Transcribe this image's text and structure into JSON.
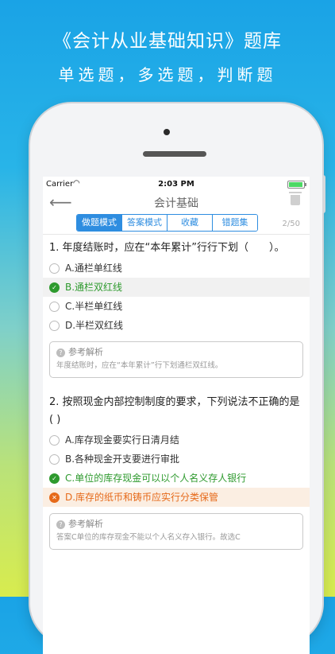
{
  "promo": {
    "headline": "《会计从业基础知识》题库",
    "subline": "单选题，多选题，判断题"
  },
  "statusbar": {
    "carrier": "Carrier",
    "wifi_icon": "wifi-icon",
    "time": "2:03 PM",
    "battery_icon": "battery-icon"
  },
  "navbar": {
    "back_icon": "back-arrow-icon",
    "title": "会计基础",
    "trash_icon": "trash-icon"
  },
  "tabs": {
    "items": [
      {
        "label": "做题模式",
        "active": true
      },
      {
        "label": "答案模式",
        "active": false
      },
      {
        "label": "收藏",
        "active": false
      },
      {
        "label": "错题集",
        "active": false
      }
    ],
    "counter": "2/50"
  },
  "questions": [
    {
      "stem": "1. 年度结账时，应在“本年累计”行行下划（　　）。",
      "options": [
        {
          "label": "A.通栏单红线",
          "state": "none"
        },
        {
          "label": "B.通栏双红线",
          "state": "correct"
        },
        {
          "label": "C.半栏单红线",
          "state": "none"
        },
        {
          "label": "D.半栏双红线",
          "state": "none"
        }
      ],
      "analysis_title": "参考解析",
      "analysis_text": "年度结账时，应在“本年累计”行下划通栏双红线。"
    },
    {
      "stem": "2. 按照现金内部控制制度的要求，下列说法不正确的是( )",
      "options": [
        {
          "label": "A.库存现金要实行日清月结",
          "state": "none"
        },
        {
          "label": "B.各种现金开支要进行审批",
          "state": "none"
        },
        {
          "label": "C.单位的库存现金可以以个人名义存人银行",
          "state": "correct"
        },
        {
          "label": "D.库存的纸币和铸币应实行分类保管",
          "state": "wrong"
        }
      ],
      "analysis_title": "参考解析",
      "analysis_text": "答案C单位的库存现金不能以个人名义存入银行。故选C"
    }
  ],
  "colors": {
    "accent": "#2e8de0",
    "correct": "#2e9a2e",
    "wrong": "#e66a1a"
  }
}
